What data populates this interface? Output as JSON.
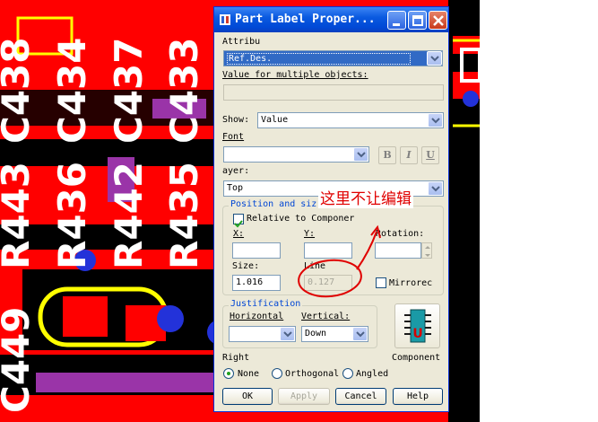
{
  "dialog": {
    "title": "Part Label Proper...",
    "attribute_label": "Attribu",
    "attribute_value": "Ref.Des.",
    "multi_label": "Value for multiple objects:",
    "multi_value": "",
    "show_label": "Show:",
    "show_value": "Value",
    "font_label": "Font",
    "font_value": "",
    "bold": "B",
    "italic": "I",
    "underline": "U",
    "layer_label": "ayer:",
    "layer_value": "Top",
    "position_group": "Position and siz",
    "relative_label": "Relative to Componer",
    "x_label": "X:",
    "y_label": "Y:",
    "rotation_label": "Rotation:",
    "x_value": "",
    "y_value": "",
    "rotation_value": "",
    "size_label": "Size:",
    "size_value": "1.016",
    "line_label": "Line",
    "line_value": "0.127",
    "mirrored_label": "Mirrorec",
    "justification_group": "Justification",
    "horizontal_label": "Horizontal",
    "vertical_label": "Vertical:",
    "horizontal_value": "",
    "vertical_value": "Down",
    "component_label": "Component",
    "right_label": "Right",
    "radio_none": "None",
    "radio_orthogonal": "Orthogonal",
    "radio_angled": "Angled",
    "ok": "OK",
    "apply": "Apply",
    "cancel": "Cancel",
    "help": "Help"
  },
  "annotation": {
    "text": "这里不让编辑",
    "color": "#e00000"
  },
  "pcb": {
    "labels": [
      "C438",
      "C434",
      "C437",
      "C433",
      "R443",
      "R436",
      "R442",
      "R435",
      "C449"
    ],
    "background": "#ff0000"
  }
}
